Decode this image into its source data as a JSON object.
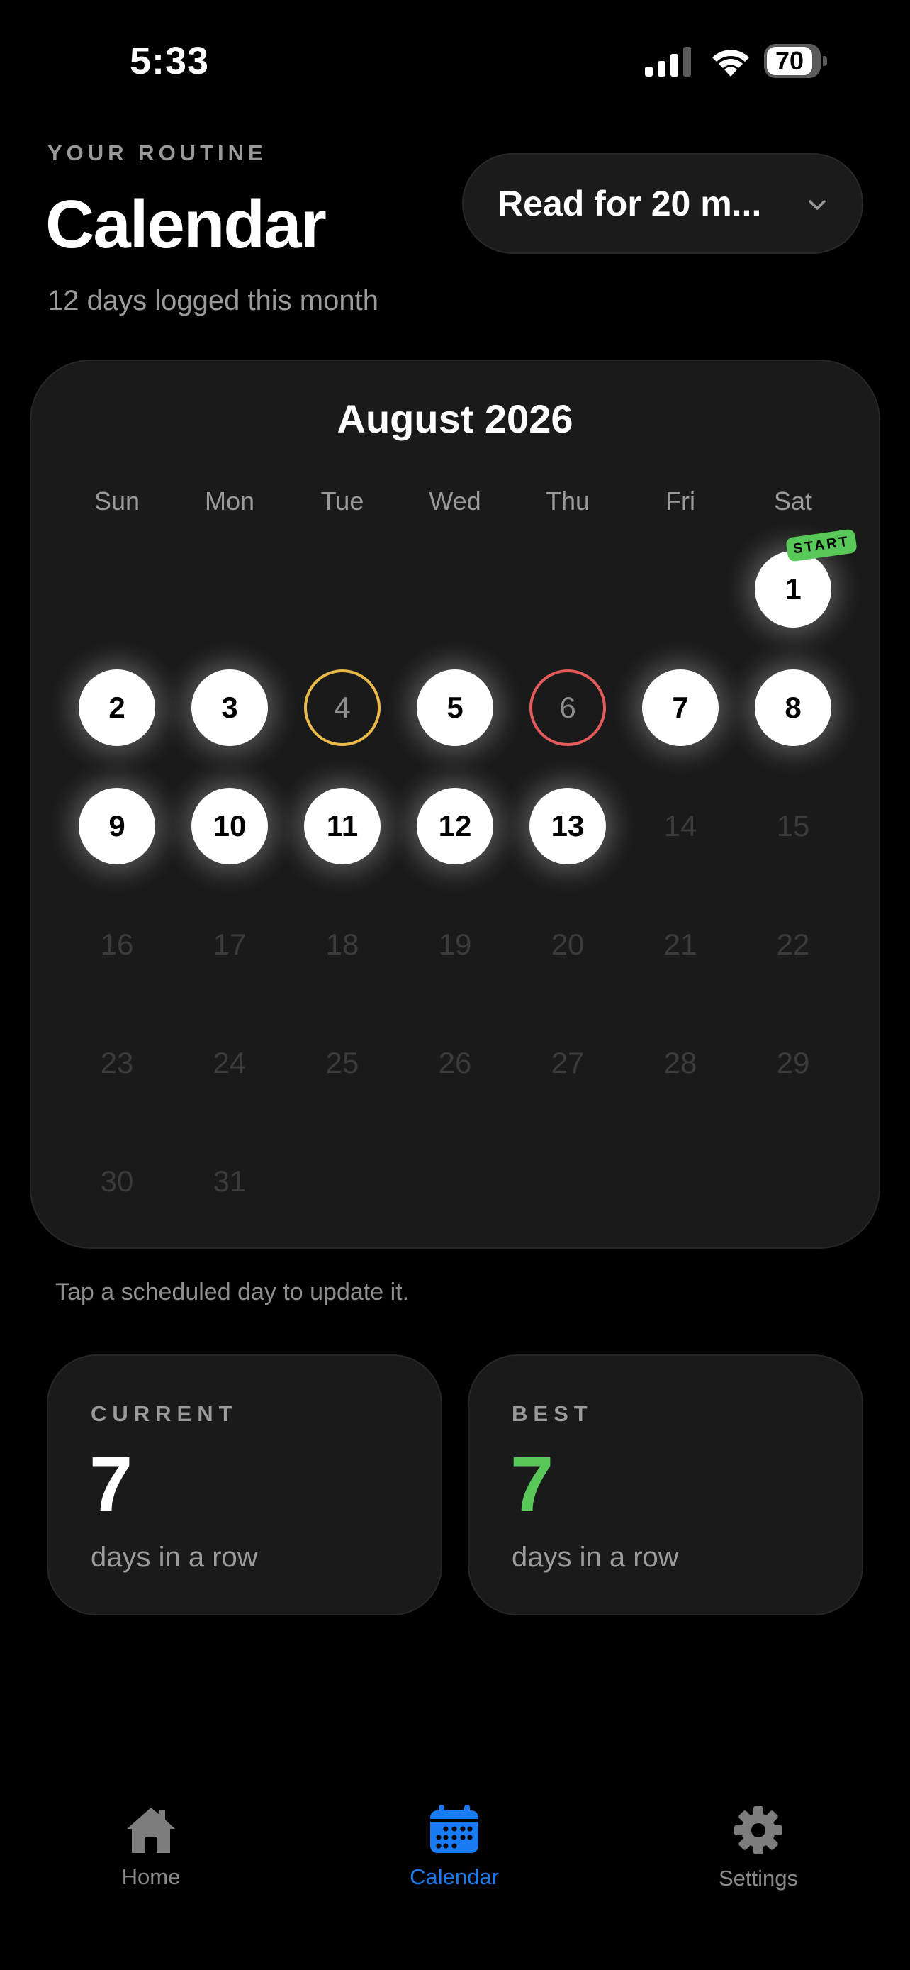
{
  "status_bar": {
    "time": "5:33",
    "battery": "70"
  },
  "header": {
    "eyebrow": "YOUR ROUTINE",
    "title": "Calendar",
    "subtitle": "12 days logged this month",
    "habit_selector": "Read for 20 m..."
  },
  "calendar": {
    "month": "August 2026",
    "weekdays": [
      "Sun",
      "Mon",
      "Tue",
      "Wed",
      "Thu",
      "Fri",
      "Sat"
    ],
    "start_badge": "START",
    "days": [
      {
        "n": "1",
        "state": "done"
      },
      {
        "n": "2",
        "state": "done"
      },
      {
        "n": "3",
        "state": "done"
      },
      {
        "n": "4",
        "state": "skipped"
      },
      {
        "n": "5",
        "state": "done"
      },
      {
        "n": "6",
        "state": "missed"
      },
      {
        "n": "7",
        "state": "done"
      },
      {
        "n": "8",
        "state": "done"
      },
      {
        "n": "9",
        "state": "done"
      },
      {
        "n": "10",
        "state": "done"
      },
      {
        "n": "11",
        "state": "done"
      },
      {
        "n": "12",
        "state": "done"
      },
      {
        "n": "13",
        "state": "done"
      },
      {
        "n": "14",
        "state": "future"
      },
      {
        "n": "15",
        "state": "future"
      },
      {
        "n": "16",
        "state": "future"
      },
      {
        "n": "17",
        "state": "future"
      },
      {
        "n": "18",
        "state": "future"
      },
      {
        "n": "19",
        "state": "future"
      },
      {
        "n": "20",
        "state": "future"
      },
      {
        "n": "21",
        "state": "future"
      },
      {
        "n": "22",
        "state": "future"
      },
      {
        "n": "23",
        "state": "future"
      },
      {
        "n": "24",
        "state": "future"
      },
      {
        "n": "25",
        "state": "future"
      },
      {
        "n": "26",
        "state": "future"
      },
      {
        "n": "27",
        "state": "future"
      },
      {
        "n": "28",
        "state": "future"
      },
      {
        "n": "29",
        "state": "future"
      },
      {
        "n": "30",
        "state": "future"
      },
      {
        "n": "31",
        "state": "future"
      }
    ]
  },
  "hint": "Tap a scheduled day to update it.",
  "stats": {
    "current": {
      "label": "CURRENT",
      "value": "7",
      "unit": "days in a row"
    },
    "best": {
      "label": "BEST",
      "value": "7",
      "unit": "days in a row"
    }
  },
  "tabs": [
    {
      "label": "Home",
      "icon": "house-icon"
    },
    {
      "label": "Calendar",
      "icon": "calendar-icon"
    },
    {
      "label": "Settings",
      "icon": "gear-icon"
    }
  ],
  "colors": {
    "accent": "#1a7cf5",
    "best_value": "#58c959",
    "start_badge": "#58c959",
    "skipped_ring": "#e9b949",
    "missed_ring": "#e45b5b"
  }
}
